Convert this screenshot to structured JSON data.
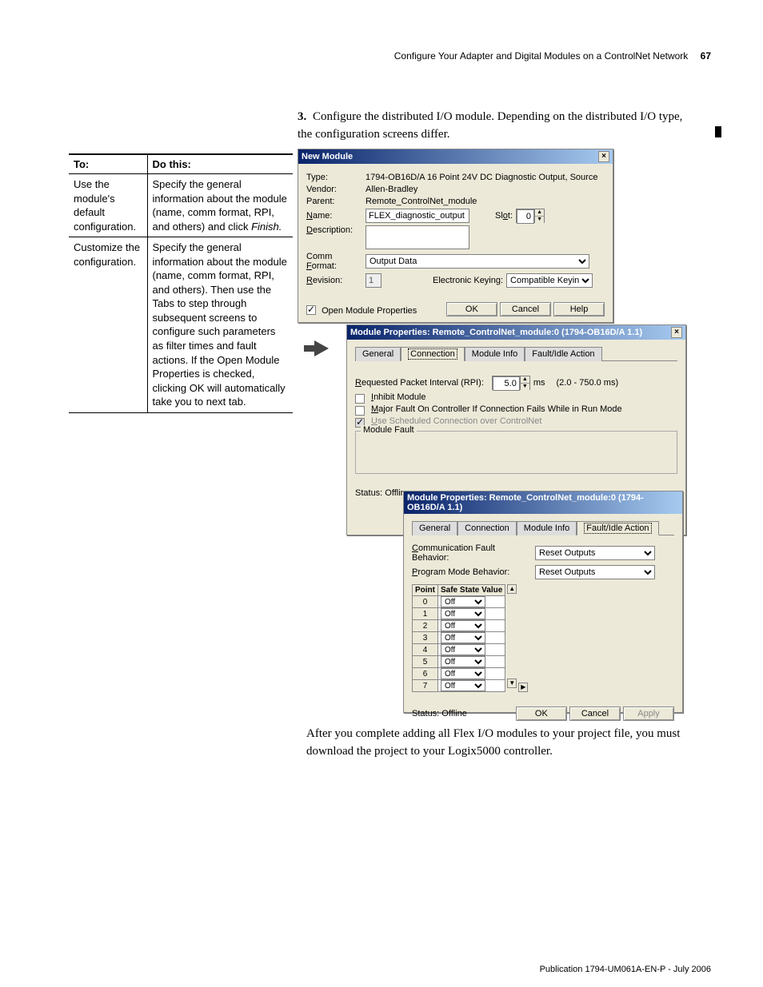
{
  "header": {
    "title": "Configure Your Adapter and Digital Modules on a ControlNet Network",
    "page": "67"
  },
  "step3": {
    "num": "3.",
    "text": "Configure the distributed I/O module. Depending on the distributed I/O type, the configuration screens differ."
  },
  "table": {
    "head_to": "To:",
    "head_do": "Do this:",
    "rows": [
      {
        "to": "Use the module's default configuration.",
        "do": "Specify the general information about the module (name, comm format, RPI, and others) and click ",
        "do_em": "Finish."
      },
      {
        "to": "Customize the configuration.",
        "do": "Specify the general information about the module (name, comm format, RPI, and others). Then use the Tabs to step through subsequent screens to configure such parameters as filter times and fault actions. If the Open Module Properties is checked, clicking OK will automatically take you to next tab.",
        "do_em": ""
      }
    ]
  },
  "dlg1": {
    "title": "New Module",
    "labels": {
      "type": "Type:",
      "vendor": "Vendor:",
      "parent": "Parent:",
      "name": "Name:",
      "slot": "Slot:",
      "description": "Description:",
      "commformat": "Comm Format:",
      "revision": "Revision:",
      "ekeying": "Electronic Keying:"
    },
    "type_val": "1794-OB16D/A 16 Point 24V DC Diagnostic Output, Source",
    "vendor_val": "Allen-Bradley",
    "parent_val": "Remote_ControlNet_module",
    "name_val": "FLEX_diagnostic_output",
    "slot_val": "0",
    "commformat_val": "Output Data",
    "revision_val": "1",
    "ekeying_val": "Compatible Keying",
    "open_props": "Open Module Properties",
    "ok": "OK",
    "cancel": "Cancel",
    "help": "Help"
  },
  "dlg2": {
    "title": "Module Properties: Remote_ControlNet_module:0 (1794-OB16D/A 1.1)",
    "tabs": {
      "general": "General",
      "connection": "Connection",
      "moduleinfo": "Module Info",
      "faultidle": "Fault/Idle Action"
    },
    "rpi_label": "Requested Packet Interval (RPI):",
    "rpi_val": "5.0",
    "rpi_unit": "ms",
    "rpi_range": "(2.0 - 750.0 ms)",
    "inhibit": "Inhibit Module",
    "majorfault": "Major Fault On Controller If Connection Fails While in Run Mode",
    "usesched": "Use Scheduled Connection over ControlNet",
    "modulefault": "Module Fault",
    "status": "Status: Offline"
  },
  "dlg3": {
    "title": "Module Properties: Remote_ControlNet_module:0 (1794-OB16D/A 1.1)",
    "tabs": {
      "general": "General",
      "connection": "Connection",
      "moduleinfo": "Module Info",
      "faultidle": "Fault/Idle Action"
    },
    "cfb_label": "Communication Fault Behavior:",
    "pmb_label": "Program Mode Behavior:",
    "reset": "Reset Outputs",
    "point_h": "Point",
    "ssv_h": "Safe State Value",
    "rows": [
      {
        "p": "0",
        "v": "Off"
      },
      {
        "p": "1",
        "v": "Off"
      },
      {
        "p": "2",
        "v": "Off"
      },
      {
        "p": "3",
        "v": "Off"
      },
      {
        "p": "4",
        "v": "Off"
      },
      {
        "p": "5",
        "v": "Off"
      },
      {
        "p": "6",
        "v": "Off"
      },
      {
        "p": "7",
        "v": "Off"
      }
    ],
    "status": "Status: Offline",
    "ok": "OK",
    "cancel": "Cancel",
    "apply": "Apply"
  },
  "after": "After you complete adding all Flex I/O modules to your project file, you must download the project to your Logix5000 controller.",
  "footer": "Publication 1794-UM061A-EN-P - July 2006"
}
